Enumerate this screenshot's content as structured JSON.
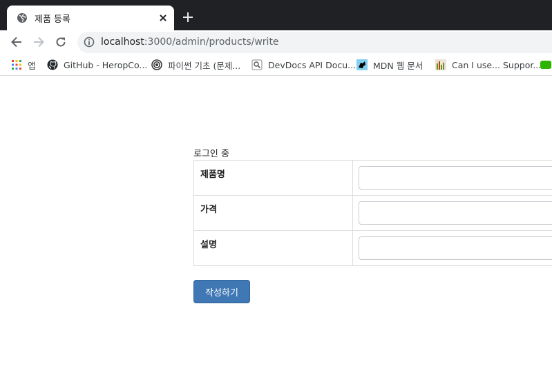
{
  "browser": {
    "tab_title": "제품 등록",
    "url_host": "localhost",
    "url_path": ":3000/admin/products/write",
    "bookmarks": [
      {
        "icon": "apps-grid-icon",
        "label": "앱"
      },
      {
        "icon": "github-icon",
        "label": "GitHub - HeropCo..."
      },
      {
        "icon": "target-icon",
        "label": "파이썬 기초 (문제..."
      },
      {
        "icon": "devdocs-icon",
        "label": "DevDocs API Docu..."
      },
      {
        "icon": "mdn-icon",
        "label": "MDN 웹 문서"
      },
      {
        "icon": "caniuse-icon",
        "label": "Can I use... Suppor..."
      }
    ]
  },
  "page": {
    "status": "로그인 중",
    "fields": [
      {
        "label": "제품명",
        "value": ""
      },
      {
        "label": "가격",
        "value": ""
      },
      {
        "label": "설명",
        "value": ""
      }
    ],
    "submit_label": "작성하기"
  },
  "colors": {
    "chrome_dark": "#202124",
    "button_blue": "#3f78b4"
  }
}
